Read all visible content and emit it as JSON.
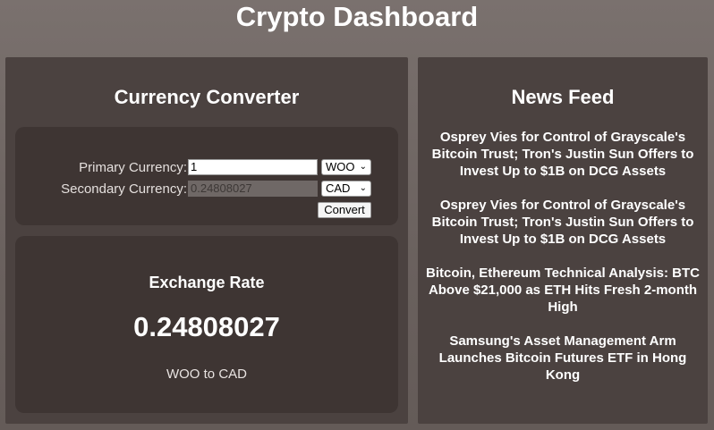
{
  "header": {
    "title": "Crypto Dashboard"
  },
  "converter": {
    "title": "Currency Converter",
    "primary_label": "Primary Currency:",
    "primary_value": "1",
    "primary_currency": "WOO",
    "secondary_label": "Secondary Currency:",
    "secondary_value": "0.24808027",
    "secondary_currency": "CAD",
    "convert_label": "Convert"
  },
  "rate": {
    "title": "Exchange Rate",
    "value": "0.24808027",
    "pair": "WOO to CAD"
  },
  "news": {
    "title": "News Feed",
    "items": [
      {
        "text": "Osprey Vies for Control of Grayscale's Bitcoin Trust; Tron's Justin Sun Offers to Invest Up to $1B on DCG Assets"
      },
      {
        "text": "Osprey Vies for Control of Grayscale's Bitcoin Trust; Tron's Justin Sun Offers to Invest Up to $1B on DCG Assets"
      },
      {
        "text": "Bitcoin, Ethereum Technical Analysis: BTC Above $21,000 as ETH Hits Fresh 2-month High"
      },
      {
        "text": "Samsung's Asset Management Arm Launches Bitcoin Futures ETF in Hong Kong"
      }
    ]
  },
  "colors": {
    "background": "#6b625f",
    "panel": "#4b4240",
    "card": "#3e3533",
    "text": "#ffffff"
  }
}
